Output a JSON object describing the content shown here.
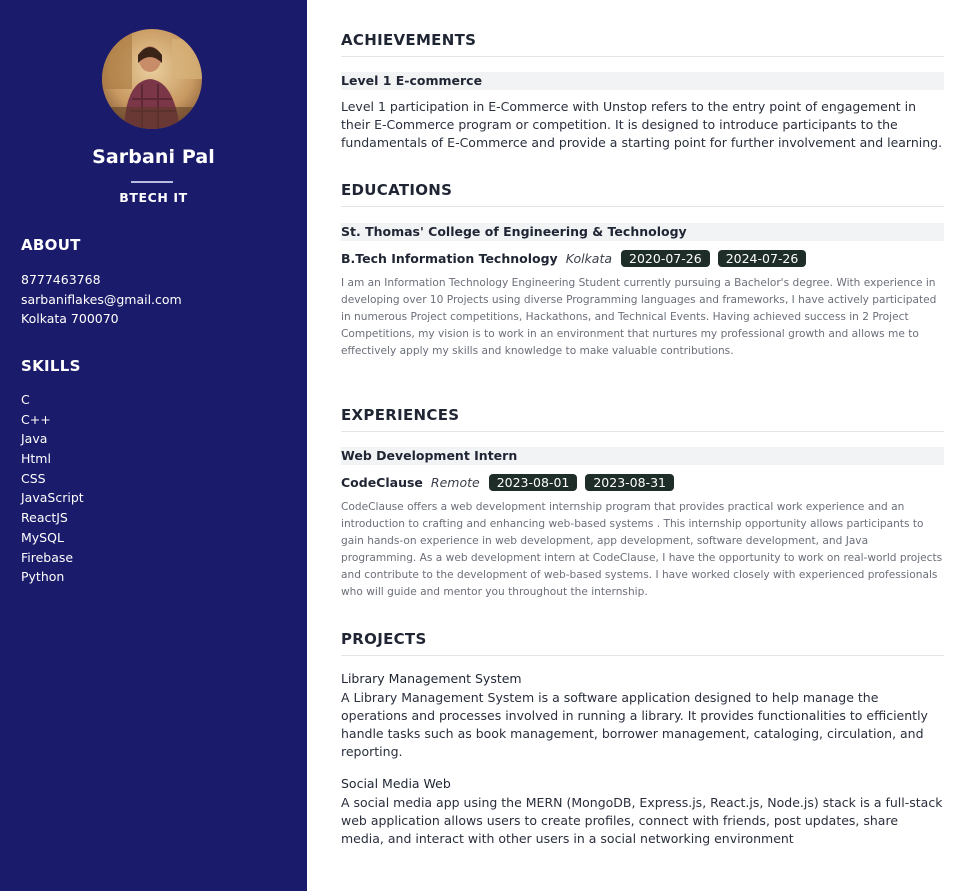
{
  "profile": {
    "name": "Sarbani Pal",
    "role": "BTECH IT"
  },
  "about": {
    "heading": "ABOUT",
    "phone": "8777463768",
    "email": "sarbaniflakes@gmail.com",
    "address": "Kolkata 700070"
  },
  "skills": {
    "heading": "SKILLS",
    "items": [
      "C",
      "C++",
      "Java",
      "Html",
      "CSS",
      "JavaScript",
      "ReactJS",
      "MySQL",
      "Firebase",
      "Python"
    ]
  },
  "achievements": {
    "heading": "ACHIEVEMENTS",
    "title": "Level 1 E-commerce",
    "description": "Level 1 participation in E-Commerce with Unstop refers to the entry point of engagement in their E-Commerce program or competition. It is designed to introduce participants to the fundamentals of E-Commerce and provide a starting point for further involvement and learning."
  },
  "educations": {
    "heading": "EDUCATIONS",
    "institution": "St. Thomas' College of Engineering & Technology",
    "degree": "B.Tech Information Technology",
    "location": "Kolkata",
    "start": "2020-07-26",
    "end": "2024-07-26",
    "description": "I am an Information Technology Engineering Student currently pursuing a Bachelor's degree. With experience in developing over 10 Projects using diverse Programming languages and frameworks, I have actively participated in numerous Project competitions, Hackathons, and Technical Events. Having achieved success in 2 Project Competitions, my vision is to work in an environment that nurtures my professional growth and allows me to effectively apply my skills and knowledge to make valuable contributions."
  },
  "experiences": {
    "heading": "EXPERIENCES",
    "position": "Web Development Intern",
    "company": "CodeClause",
    "mode": "Remote",
    "start": "2023-08-01",
    "end": "2023-08-31",
    "description": "CodeClause offers a web development internship program that provides practical work experience and an introduction to crafting and enhancing web-based systems . This internship opportunity allows participants to gain hands-on experience in web development, app development, software development, and Java programming. As a web development intern at CodeClause, I have the opportunity to work on real-world projects and contribute to the development of web-based systems. I have worked closely with experienced professionals who will guide and mentor you throughout the internship."
  },
  "projects": {
    "heading": "PROJECTS",
    "items": [
      {
        "title": "Library Management System",
        "description": "A Library Management System is a software application designed to help manage the operations and processes involved in running a library. It provides functionalities to efficiently handle tasks such as book management, borrower management, cataloging, circulation, and reporting."
      },
      {
        "title": "Social Media Web",
        "description": "A social media app using the MERN (MongoDB, Express.js, React.js, Node.js) stack is a full-stack web application allows users to create profiles, connect with friends, post updates, share media, and interact with other users in a social networking environment"
      }
    ]
  },
  "colors": {
    "sidebar": "#1b1b6b",
    "badge": "#1f2d29",
    "item_bar": "#f2f3f5"
  }
}
